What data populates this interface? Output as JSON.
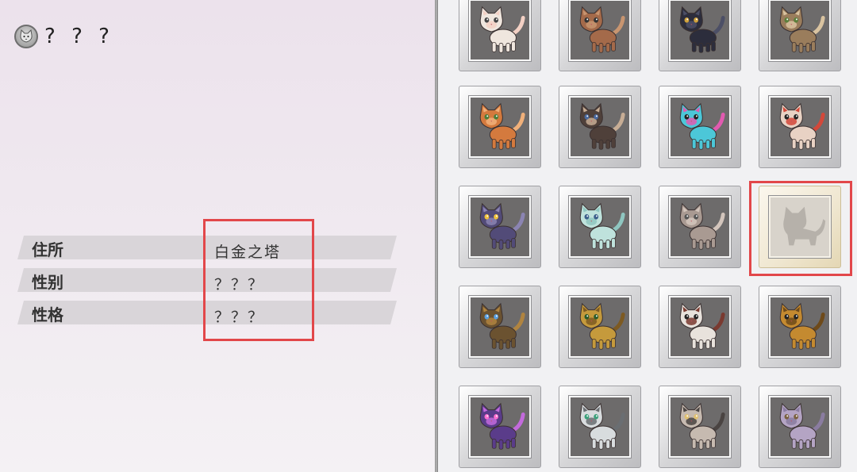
{
  "profile": {
    "icon": "cat-face-icon",
    "name": "? ? ?",
    "rows": [
      {
        "label": "住所",
        "value": "白金之塔"
      },
      {
        "label": "性别",
        "value": "？？？"
      },
      {
        "label": "性格",
        "value": "？？？"
      }
    ]
  },
  "collection": {
    "slots": [
      {
        "name": "white-cat",
        "body": "#efe6de",
        "accent": "#f3d0c4",
        "eye": "#444"
      },
      {
        "name": "brown-cat",
        "body": "#a46a4a",
        "accent": "#c89570",
        "eye": "#333"
      },
      {
        "name": "black-cat",
        "body": "#2c2d3c",
        "accent": "#4c4f66",
        "eye": "#cfa13c"
      },
      {
        "name": "tabby-longhair-cat",
        "body": "#9a7d5c",
        "accent": "#d9c3a0",
        "eye": "#5b7f3b"
      },
      {
        "name": "orange-tabby-cat",
        "body": "#d47a3e",
        "accent": "#f0b07a",
        "eye": "#4b7d3a"
      },
      {
        "name": "siamese-cat",
        "body": "#4f403a",
        "accent": "#c7ad95",
        "eye": "#4a6aa0"
      },
      {
        "name": "cyan-robot-cat",
        "body": "#4cc7d8",
        "accent": "#e15ab0",
        "eye": "#222"
      },
      {
        "name": "calico-robot-cat",
        "body": "#e8d2c4",
        "accent": "#d2483a",
        "eye": "#222"
      },
      {
        "name": "persian-cat",
        "body": "#524b78",
        "accent": "#8b84b2",
        "eye": "#f0c23a"
      },
      {
        "name": "mint-tabby-cat",
        "body": "#bfe2dc",
        "accent": "#8fc6c0",
        "eye": "#3b5f8a"
      },
      {
        "name": "grey-tabby-cat",
        "body": "#a99a92",
        "accent": "#d3c5bc",
        "eye": "#555"
      },
      {
        "name": "locked-silhouette",
        "locked": true
      },
      {
        "name": "bronze-robot-cat",
        "body": "#6b5230",
        "accent": "#b08440",
        "eye": "#5aa0e0"
      },
      {
        "name": "gold-steampunk-cat",
        "body": "#c59a3c",
        "accent": "#7d5a22",
        "eye": "#2a5a2a"
      },
      {
        "name": "skull-robot-cat",
        "body": "#e8e2dc",
        "accent": "#7a3a30",
        "eye": "#222"
      },
      {
        "name": "golden-mech-cat",
        "body": "#c48a30",
        "accent": "#6e4a1a",
        "eye": "#222"
      },
      {
        "name": "purple-robot-cat",
        "body": "#5a3c8a",
        "accent": "#c36adc",
        "eye": "#ff6fd0"
      },
      {
        "name": "silver-robot-cat",
        "body": "#d8dcde",
        "accent": "#6a6e72",
        "eye": "#3aa07a"
      },
      {
        "name": "raccoon-cat",
        "body": "#c6bab0",
        "accent": "#4a4442",
        "eye": "#e0c070"
      },
      {
        "name": "lilac-tabby-cat",
        "body": "#b4a4c4",
        "accent": "#8a7ca0",
        "eye": "#7a6040"
      }
    ]
  }
}
